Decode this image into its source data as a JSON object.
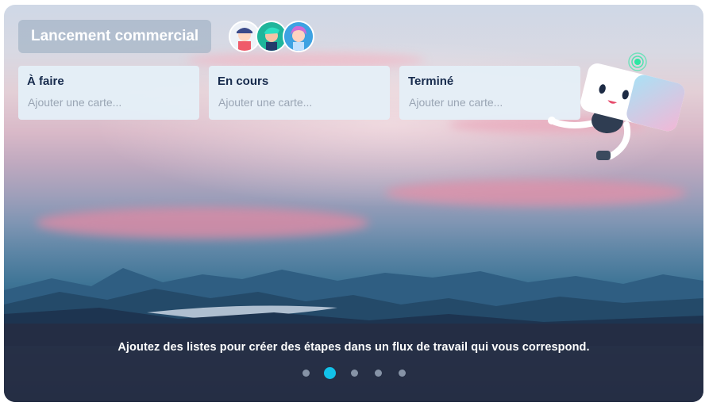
{
  "board": {
    "title": "Lancement commercial",
    "avatars": [
      {
        "icon": "avatar-person-1-icon",
        "bg": "#e9eef6"
      },
      {
        "icon": "avatar-person-2-icon",
        "bg": "#20b39c"
      },
      {
        "icon": "avatar-person-3-icon",
        "bg": "#3fa3e3"
      }
    ]
  },
  "lists": [
    {
      "title": "À faire",
      "add_placeholder": "Ajouter une carte..."
    },
    {
      "title": "En cours",
      "add_placeholder": "Ajouter une carte..."
    },
    {
      "title": "Terminé",
      "add_placeholder": "Ajouter une carte..."
    }
  ],
  "onboarding": {
    "caption": "Ajoutez des listes pour créer des étapes dans un flux de travail qui vous correspond.",
    "step_count": 5,
    "active_step": 2
  },
  "colors": {
    "accent": "#12c2e9",
    "list_title": "#172b4d",
    "placeholder": "#9aa5b4",
    "bar": "#262c42"
  },
  "mascot": {
    "icon": "robot-mascot-icon"
  }
}
